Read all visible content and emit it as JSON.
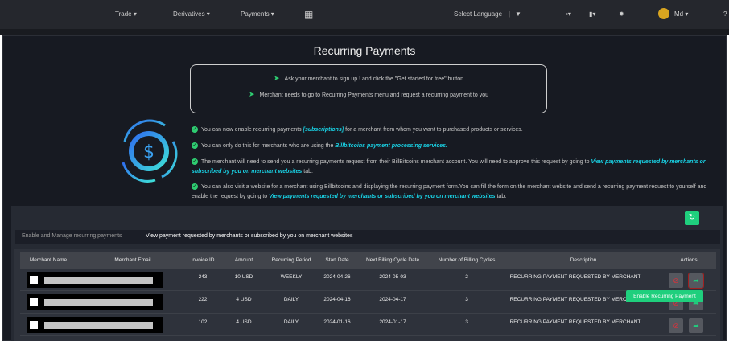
{
  "nav": {
    "trade": "Trade ▾",
    "derivatives": "Derivatives ▾",
    "payments": "Payments ▾",
    "language": "Select Language",
    "language_caret": "▼",
    "user": "Md ▾"
  },
  "title": "Recurring Payments",
  "steps": [
    "Ask your merchant to sign up ! and click the \"Get started for free\" button",
    "Merchant needs to go to Recurring Payments menu and request a recurring payment to you"
  ],
  "info": [
    {
      "pre": "You can now enable recurring payments ",
      "link": "[subscriptions]",
      "post": " for a merchant from whom you want to purchased products or services."
    },
    {
      "pre": "You can only do this for merchants who are using the ",
      "link": "Billbitcoins payment processing services.",
      "post": ""
    },
    {
      "pre": "The merchant will need to send you a recurring payments request from their BillBitcoins merchant account. You will need to approve this request by going to ",
      "link": "View payments requested by merchants or subscribed by you on merchant websites",
      "post": " tab."
    },
    {
      "pre": "You can also visit a website for a merchant using Billbitcoins and displaying the recurring payment form.You can fill the form on the merchant website and send a recurring payment request to yourself and enable the request by going to ",
      "link": "View payments requested by merchants or subscribed by you on merchant websites",
      "post": " tab."
    }
  ],
  "tabs": [
    "Enable and Manage recurring payments",
    "View payment requested by merchants or subscribed by you on merchant websites"
  ],
  "table": {
    "headers": [
      "Merchant Name",
      "Merchant Email",
      "Invoice ID",
      "Amount",
      "Recurring Period",
      "Start Date",
      "Next Billing Cycle Date",
      "Number of Billing Cycles",
      "Description",
      "Actions"
    ],
    "rows": [
      [
        "243",
        "10 USD",
        "WEEKLY",
        "2024-04-26",
        "2024-05-03",
        "2",
        "RECURRING PAYMENT REQUESTED BY MERCHANT"
      ],
      [
        "222",
        "4 USD",
        "DAILY",
        "2024-04-16",
        "2024-04-17",
        "3",
        "RECURRING PAYMENT REQUESTED BY MERCHANT"
      ],
      [
        "102",
        "4 USD",
        "DAILY",
        "2024-01-16",
        "2024-01-17",
        "3",
        "RECURRING PAYMENT REQUESTED BY MERCHANT"
      ]
    ]
  },
  "tooltip": "Enable Recurring Payment",
  "colors": {
    "accent": "#1fcf7d",
    "link": "#19d3e6",
    "danger": "#e0303a"
  }
}
